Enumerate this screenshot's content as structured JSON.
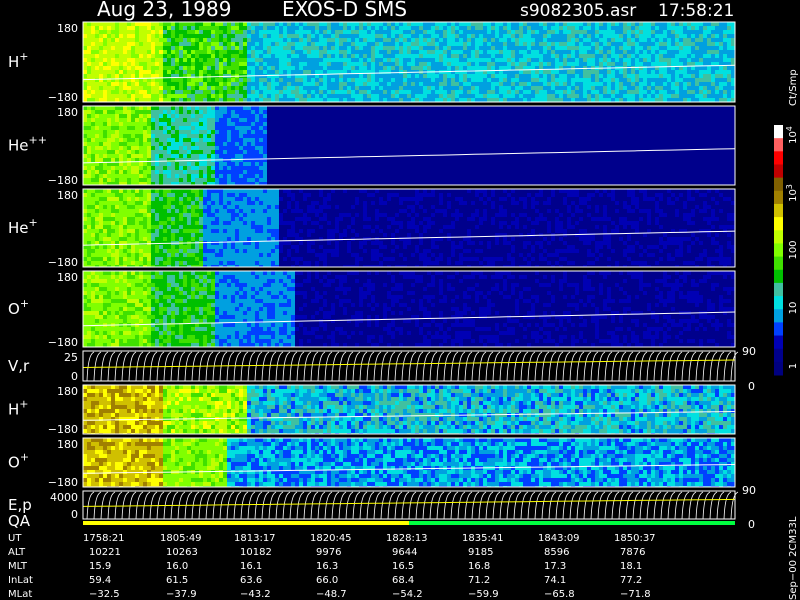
{
  "header": {
    "date": "Aug 23, 1989",
    "instrument": "EXOS-D SMS",
    "file": "s9082305.asr",
    "time": "17:58:21"
  },
  "panels": [
    {
      "id": "hplus",
      "species": "H",
      "sup": "+",
      "top": "180",
      "bottom": "−180"
    },
    {
      "id": "heplusplus",
      "species": "He",
      "sup": "++",
      "top": "180",
      "bottom": "−180"
    },
    {
      "id": "heplus",
      "species": "He",
      "sup": "+",
      "top": "180",
      "bottom": "−180"
    },
    {
      "id": "oplus",
      "species": "O",
      "sup": "+",
      "top": "180",
      "bottom": "−180"
    },
    {
      "id": "vr",
      "label": "V,r",
      "top": "25",
      "bottom": "0",
      "right_top": "90",
      "right_bottom": "0"
    },
    {
      "id": "hplus2",
      "species": "H",
      "sup": "+",
      "top": "180",
      "bottom": "−180"
    },
    {
      "id": "oplus2",
      "species": "O",
      "sup": "+",
      "top": "180",
      "bottom": "−180"
    },
    {
      "id": "ep",
      "label": "E,p",
      "top": "4000",
      "bottom": "0",
      "right_top": "90",
      "right_bottom": "0"
    }
  ],
  "qa": {
    "label": "QA"
  },
  "colorbar": {
    "unit": "Ct/Smp",
    "labels": [
      {
        "base": "10",
        "exp": "4"
      },
      {
        "base": "10",
        "exp": "3"
      },
      {
        "base": "100",
        "exp": ""
      },
      {
        "base": "10",
        "exp": ""
      },
      {
        "base": "1",
        "exp": ""
      }
    ],
    "colors": [
      "#000080",
      "#00008c",
      "#0000b4",
      "#0040ff",
      "#00a0e0",
      "#00e0e0",
      "#40c0a0",
      "#00c000",
      "#40e000",
      "#80ff00",
      "#c0ff00",
      "#ffff00",
      "#d0c000",
      "#a08000",
      "#806000",
      "#c00000",
      "#ff0000",
      "#ff6060",
      "#ffffff"
    ]
  },
  "footer": {
    "row_labels": [
      "UT",
      "ALT",
      "MLT",
      "InLat",
      "MLat"
    ],
    "columns": [
      [
        "1758:21",
        "10221",
        "15.9",
        "59.4",
        "−32.5"
      ],
      [
        "1805:49",
        "10263",
        "16.0",
        "61.5",
        "−37.9"
      ],
      [
        "1813:17",
        "10182",
        "16.1",
        "63.6",
        "−43.2"
      ],
      [
        "1820:45",
        "9976",
        "16.3",
        "66.0",
        "−48.7"
      ],
      [
        "1828:13",
        "9644",
        "16.5",
        "68.4",
        "−54.2"
      ],
      [
        "1835:41",
        "9185",
        "16.8",
        "71.2",
        "−59.9"
      ],
      [
        "1843:09",
        "8596",
        "17.3",
        "74.1",
        "−65.8"
      ],
      [
        "1850:37",
        "7876",
        "18.1",
        "77.2",
        "−71.8"
      ]
    ],
    "stamp": "Sep−00 2CM33L"
  },
  "chart_data": {
    "type": "heatmap",
    "title": "Aug 23, 1989 EXOS-D SMS",
    "x_ticks": [
      "1758:21",
      "1805:49",
      "1813:17",
      "1820:45",
      "1828:13",
      "1835:41",
      "1843:09",
      "1850:37"
    ],
    "series": [
      {
        "name": "H+",
        "ylim": [
          -180,
          180
        ]
      },
      {
        "name": "He++",
        "ylim": [
          -180,
          180
        ]
      },
      {
        "name": "He+",
        "ylim": [
          -180,
          180
        ]
      },
      {
        "name": "O+",
        "ylim": [
          -180,
          180
        ]
      },
      {
        "name": "V,r",
        "ylim": [
          0,
          25
        ]
      },
      {
        "name": "H+",
        "ylim": [
          -180,
          180
        ]
      },
      {
        "name": "O+",
        "ylim": [
          -180,
          180
        ]
      },
      {
        "name": "E,p",
        "ylim": [
          0,
          4000
        ]
      }
    ],
    "color_scale": "log",
    "color_range": [
      1,
      10000
    ],
    "color_unit": "Ct/Smp"
  }
}
